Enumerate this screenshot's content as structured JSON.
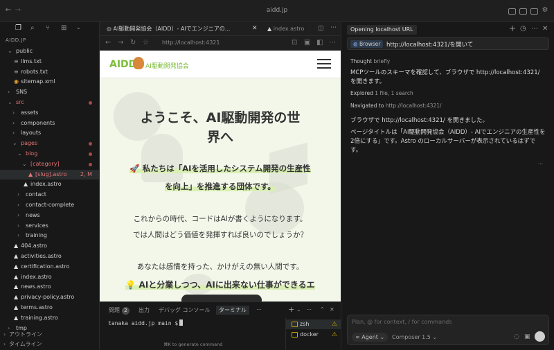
{
  "window": {
    "title": "aidd.jp"
  },
  "sidebar": {
    "header": "AIDD.JP",
    "tree": [
      {
        "label": "public",
        "kind": "folder-open",
        "depth": 1,
        "color": "normal"
      },
      {
        "label": "llms.txt",
        "kind": "file-lines",
        "depth": 2,
        "color": "normal"
      },
      {
        "label": "robots.txt",
        "kind": "file-lines",
        "depth": 2,
        "color": "normal"
      },
      {
        "label": "sitemap.xml",
        "kind": "file-rss",
        "depth": 2,
        "color": "normal"
      },
      {
        "label": "SNS",
        "kind": "folder",
        "depth": 1,
        "color": "normal"
      },
      {
        "label": "src",
        "kind": "folder-open",
        "depth": 1,
        "color": "red",
        "dot": true
      },
      {
        "label": "assets",
        "kind": "folder",
        "depth": 2,
        "color": "normal"
      },
      {
        "label": "components",
        "kind": "folder",
        "depth": 2,
        "color": "normal"
      },
      {
        "label": "layouts",
        "kind": "folder",
        "depth": 2,
        "color": "normal"
      },
      {
        "label": "pages",
        "kind": "folder-open",
        "depth": 2,
        "color": "red",
        "dot": true
      },
      {
        "label": "blog",
        "kind": "folder-open",
        "depth": 3,
        "color": "red",
        "dot": true
      },
      {
        "label": "[category]",
        "kind": "folder-open",
        "depth": 4,
        "color": "red",
        "dot": true
      },
      {
        "label": "[slug].astro",
        "kind": "file-astro",
        "depth": 5,
        "color": "red",
        "selected": true,
        "badge": "2, M"
      },
      {
        "label": "index.astro",
        "kind": "file-astro",
        "depth": 4,
        "color": "normal"
      },
      {
        "label": "contact",
        "kind": "folder",
        "depth": 3,
        "color": "normal"
      },
      {
        "label": "contact-complete",
        "kind": "folder",
        "depth": 3,
        "color": "normal"
      },
      {
        "label": "news",
        "kind": "folder",
        "depth": 3,
        "color": "normal"
      },
      {
        "label": "services",
        "kind": "folder",
        "depth": 3,
        "color": "normal"
      },
      {
        "label": "training",
        "kind": "folder",
        "depth": 3,
        "color": "normal"
      },
      {
        "label": "404.astro",
        "kind": "file-astro",
        "depth": 2,
        "color": "normal"
      },
      {
        "label": "activities.astro",
        "kind": "file-astro",
        "depth": 2,
        "color": "normal"
      },
      {
        "label": "certification.astro",
        "kind": "file-astro",
        "depth": 2,
        "color": "normal"
      },
      {
        "label": "index.astro",
        "kind": "file-astro",
        "depth": 2,
        "color": "normal"
      },
      {
        "label": "news.astro",
        "kind": "file-astro",
        "depth": 2,
        "color": "normal"
      },
      {
        "label": "privacy-policy.astro",
        "kind": "file-astro",
        "depth": 2,
        "color": "normal"
      },
      {
        "label": "terms.astro",
        "kind": "file-astro",
        "depth": 2,
        "color": "normal"
      },
      {
        "label": "training.astro",
        "kind": "file-astro",
        "depth": 2,
        "color": "normal"
      },
      {
        "label": "tmp",
        "kind": "folder",
        "depth": 1,
        "color": "normal"
      }
    ],
    "outline_label": "アウトライン",
    "timeline_label": "タイムライン"
  },
  "editor": {
    "tabs": [
      {
        "label": "AI駆動開発協会（AIDD）- AIでエンジニアの...",
        "active": true
      },
      {
        "label": "index.astro",
        "active": false
      }
    ],
    "browser": {
      "url": "http://localhost:4321"
    }
  },
  "webpage": {
    "logo_text": "AIDD",
    "logo_sub": "AI駆動開発協会",
    "heading_line1": "ようこそ、AI駆動開発の世",
    "heading_line2": "界へ",
    "mission_line1": "🚀 私たちは「AIを活用したシステム開発の生産性",
    "mission_line2": "を向上」を推進する団体です。",
    "para1_line1": "これからの時代、コードはAIが書くようになります。",
    "para1_line2": "では人間はどう価値を発揮すれば良いのでしょうか？",
    "para2": "あなたは感情を持った、かけがえの無い人間です。",
    "para3": "💡 AIと分業しつつ、AIに出来ない仕事ができるエ"
  },
  "panel": {
    "tabs": [
      {
        "label": "問題",
        "badge": "2"
      },
      {
        "label": "出力"
      },
      {
        "label": "デバッグ コンソール"
      },
      {
        "label": "ターミナル",
        "active": true
      }
    ],
    "prompt": "tanaka aidd.jp main $",
    "hint": "⌘K to generate command",
    "terminals": [
      "zsh",
      "docker"
    ]
  },
  "agent": {
    "tab_label": "Opening localhost URL",
    "user_chip": "Browser",
    "user_message": "http://localhost:4321/を開いて",
    "thought_label": "Thought",
    "thought_value": "briefly",
    "message1": "MCPツールのスキーマを確認して、ブラウザで http://localhost:4321/ を開きます。",
    "explored_label": "Explored",
    "explored_value": "1 file, 1 search",
    "navigated_label": "Navigated to",
    "navigated_value": "http://localhost:4321/",
    "message2": "ブラウザで http://localhost:4321/ を開きました。",
    "message3": "ページタイトルは「AI駆動開発協会（AIDD）- AIでエンジニアの生産性を2倍にする」です。Astro のローカルサーバーが表示されているはずです。",
    "more": "...",
    "composer_placeholder": "Plan, @ for context, / for commands",
    "mode": "Agent",
    "model": "Composer 1.5"
  },
  "colors": {
    "accent_red": "#e57373",
    "brand_green": "#7dbd3a",
    "page_bg": "#f2f7ea",
    "warning": "#cca700"
  }
}
